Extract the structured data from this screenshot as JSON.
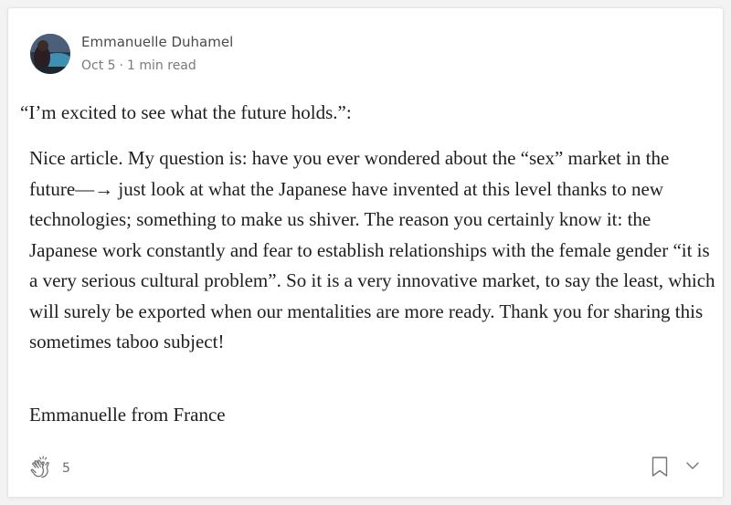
{
  "author": {
    "name": "Emmanuelle Duhamel",
    "date": "Oct 5",
    "separator": "·",
    "read_time": "1 min read"
  },
  "response": {
    "quoted": "“I’m excited to see what the future holds.”:",
    "body": "Nice article. My question is: have you ever wondered about the “sex” market in the future—→ just look at what the Japanese have invented at this level thanks to new technologies; something to make us shiver. The reason you certainly know it: the Japanese work constantly and fear to establish relationships with the female gender “it is a very serious cultural problem”. So it is a very innovative market, to say the least, which will surely be exported when our mentalities are more ready. Thank you for sharing this sometimes taboo subject!",
    "signoff": "Emmanuelle from France"
  },
  "footer": {
    "clap_count": "5",
    "icons": [
      "clap-icon",
      "bookmark-icon",
      "chevron-down-icon"
    ]
  },
  "colors": {
    "text": "#1e1e1e",
    "meta": "#7a7a7a",
    "icon": "#757575"
  }
}
